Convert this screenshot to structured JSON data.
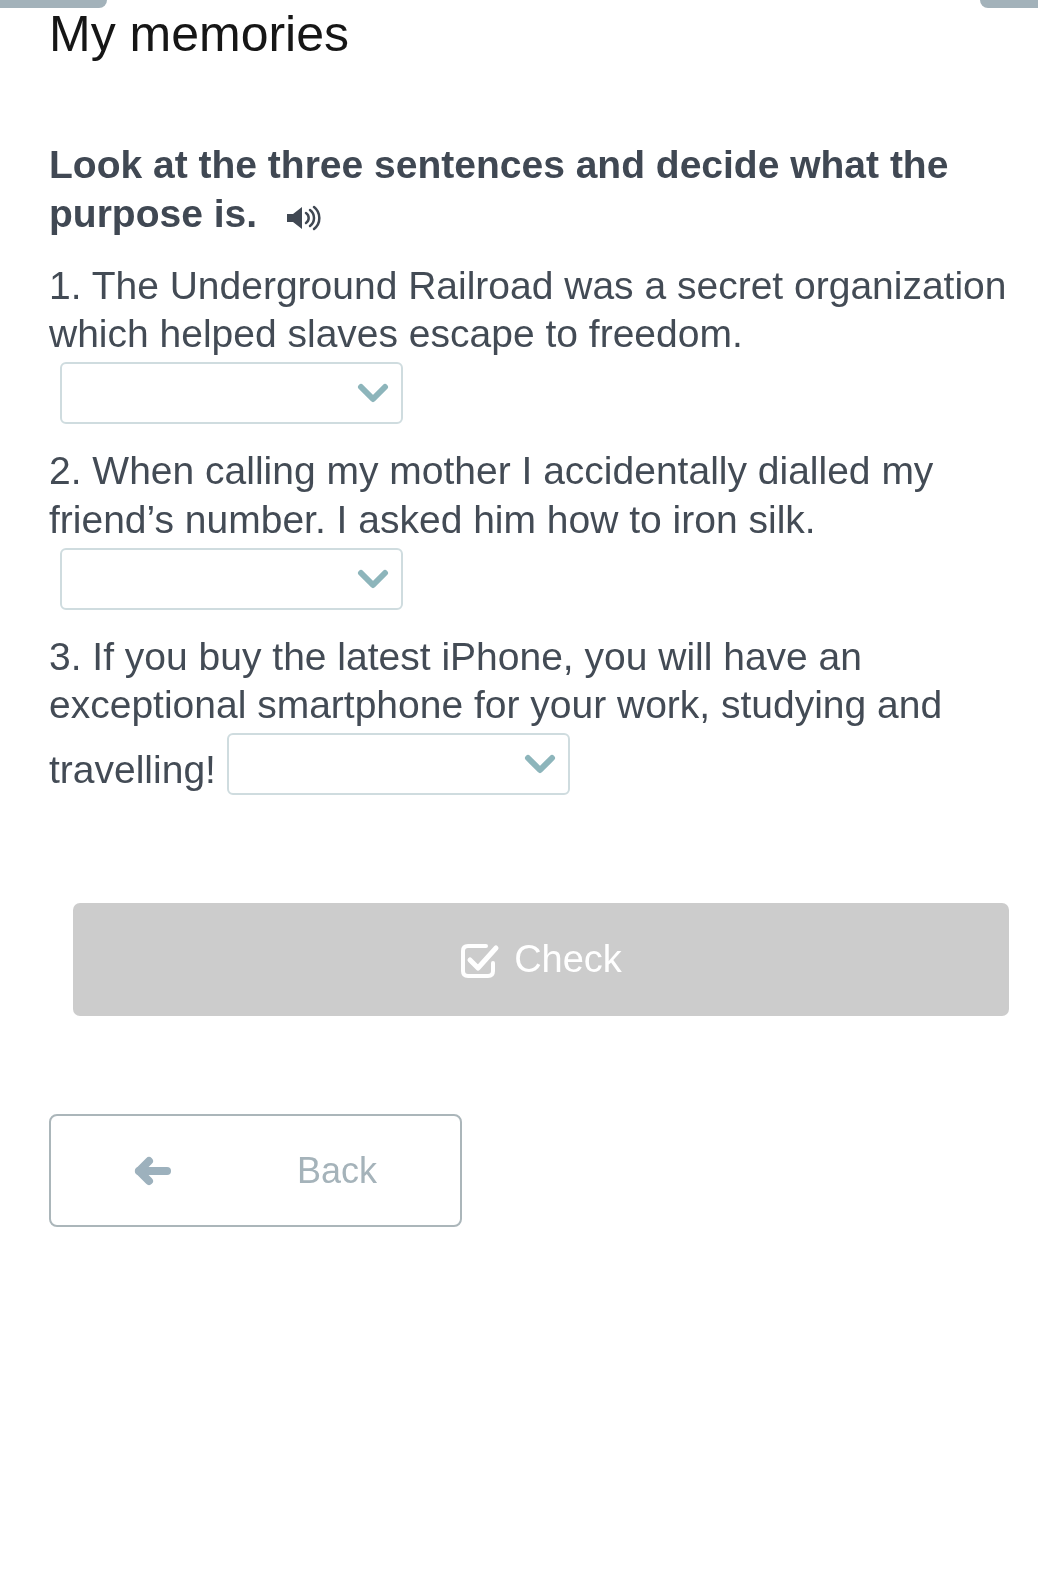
{
  "title": "My memories",
  "task": {
    "instruction_lines": [
      "Look at the three sentences and decide what the",
      "purpose is."
    ],
    "items": [
      {
        "lines": [
          "1. The Underground Railroad was a secret organization",
          "which helped slaves escape to freedom."
        ]
      },
      {
        "lines": [
          "2. When calling my mother I accidentally dialled my",
          "friend’s number. I asked him how to iron silk."
        ]
      },
      {
        "lines": [
          "3. If you buy the latest iPhone, you will have an",
          "exceptional smartphone for your work, studying and",
          "travelling!"
        ]
      }
    ]
  },
  "check_button": {
    "label": "Check",
    "disabled": true
  },
  "back_button": {
    "label": "Back"
  }
}
